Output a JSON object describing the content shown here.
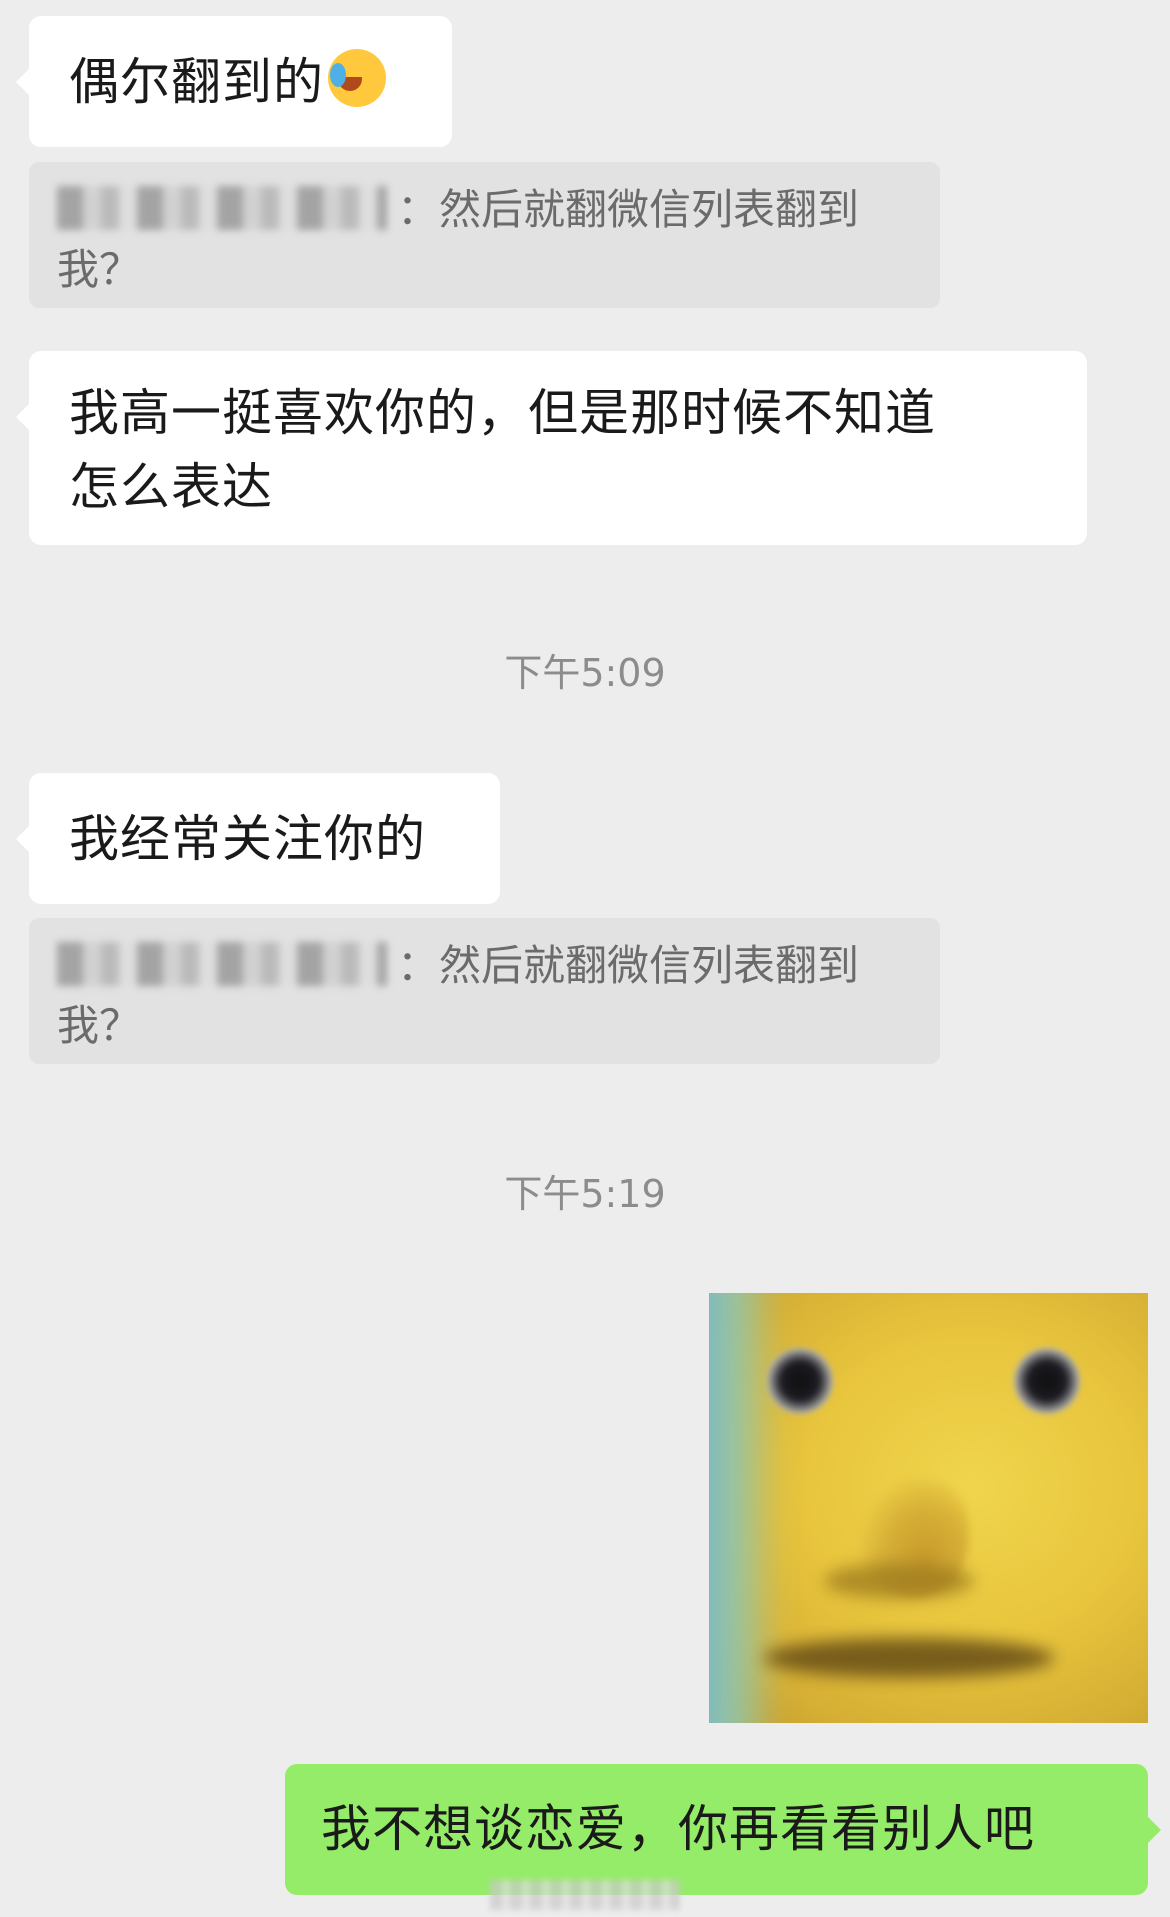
{
  "colors": {
    "chat_background": "#ededed",
    "incoming_bubble": "#ffffff",
    "outgoing_bubble": "#95ec69",
    "quote_background": "#e2e2e2",
    "timestamp_text": "#8c8c8c"
  },
  "messages": [
    {
      "side": "left",
      "type": "text",
      "text": "偶尔翻到的",
      "emoji": "face-with-tears-of-joy-icon"
    },
    {
      "side": "left",
      "type": "quote",
      "author_hidden": true,
      "text": "：然后就翻微信列表翻到\n我？"
    },
    {
      "side": "left",
      "type": "text",
      "text": "我高一挺喜欢你的，但是那时候不知道\n怎么表达"
    },
    {
      "type": "timestamp",
      "text": "下午5:09"
    },
    {
      "side": "left",
      "type": "text",
      "text": "我经常关注你的"
    },
    {
      "side": "left",
      "type": "quote",
      "author_hidden": true,
      "text": "：然后就翻微信列表翻到\n我？"
    },
    {
      "type": "timestamp",
      "text": "下午5:19"
    },
    {
      "side": "right",
      "type": "sticker",
      "sticker": "yellow-face-sticker"
    },
    {
      "side": "right",
      "type": "text",
      "text": "我不想谈恋爱，你再看看别人吧"
    }
  ]
}
